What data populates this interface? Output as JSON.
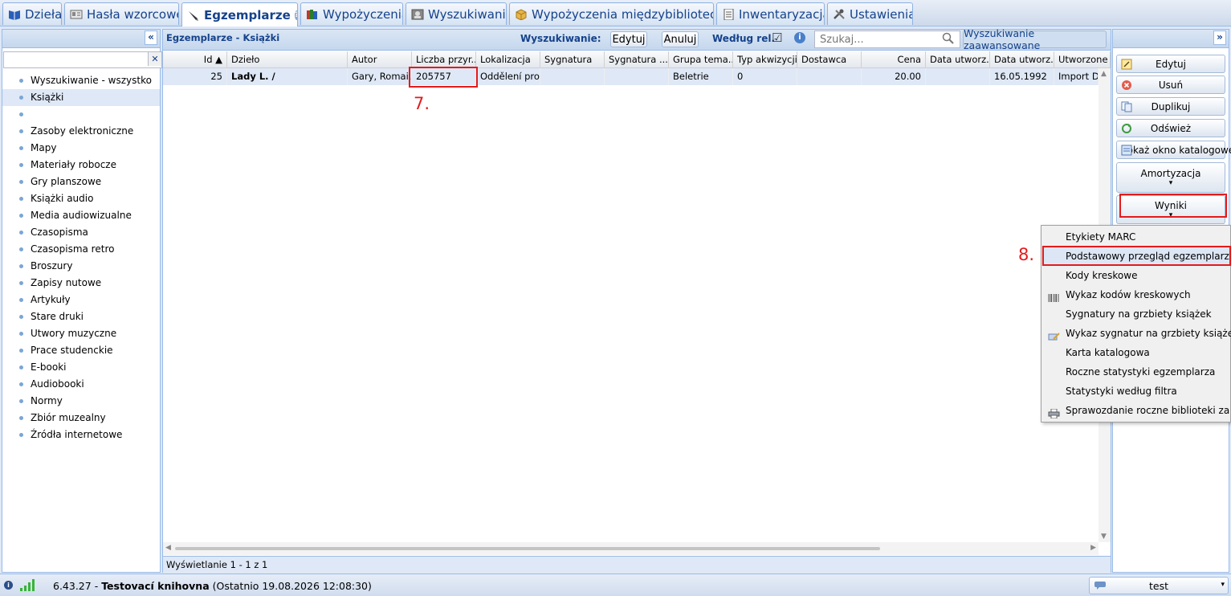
{
  "tabs": [
    {
      "label": "Dzieła",
      "icon": "book-icon"
    },
    {
      "label": "Hasła wzorcowe",
      "icon": "card-icon"
    },
    {
      "label": "Egzemplarze",
      "icon": "pen-icon"
    },
    {
      "label": "Wypożyczenia",
      "icon": "books-icon"
    },
    {
      "label": "Wyszukiwanie",
      "icon": "photo-icon"
    },
    {
      "label": "Wypożyczenia międzybiblioteczne",
      "icon": "box-icon"
    },
    {
      "label": "Inwentaryzacja",
      "icon": "document-icon"
    },
    {
      "label": "Ustawienia",
      "icon": "tools-icon"
    }
  ],
  "sidebar": {
    "collapse_glyph": "«",
    "clear_glyph": "✕",
    "items": [
      "Wyszukiwanie - wszystko",
      "Książki",
      "",
      "Zasoby elektroniczne",
      "Mapy",
      "Materiały robocze",
      "Gry planszowe",
      "Książki audio",
      "Media audiowizualne",
      "Czasopisma",
      "Czasopisma retro",
      "Broszury",
      "Zapisy nutowe",
      "Artykuły",
      "Stare druki",
      "Utwory muzyczne",
      "Prace studenckie",
      "E-booki",
      "Audiobooki",
      "Normy",
      "Zbiór muzealny",
      "Źródła internetowe"
    ]
  },
  "center": {
    "title": "Egzemplarze - Książki",
    "search_label": "Wyszukiwanie:",
    "edit_label": "Edytuj",
    "cancel_label": "Anuluj",
    "relevance_label": "Według rel.",
    "relevance_checked": "☑",
    "info_glyph": "i",
    "search_placeholder": "Szukaj...",
    "advanced_label": "Wyszukiwanie zaawansowane",
    "footer": "Wyświetlanie 1 - 1 z 1"
  },
  "grid": {
    "columns": [
      "Id ▲",
      "Dzieło",
      "Autor",
      "Liczba przyr...",
      "Lokalizacja",
      "Sygnatura",
      "Sygnatura ...",
      "Grupa tema...",
      "Typ akwizycji",
      "Dostawca",
      "Cena",
      "Data utworz...",
      "Data utworz...",
      "Utworzone ..."
    ],
    "row": [
      "25",
      "Lady L. /",
      "Gary, Romai...",
      "205757",
      "Oddělení pro...",
      "",
      "",
      "Beletrie",
      "0",
      "",
      "20.00",
      "",
      "16.05.1992",
      "Import Da"
    ]
  },
  "actions": {
    "collapse_glyph": "»",
    "edit": "Edytuj",
    "delete": "Usuń",
    "duplicate": "Duplikuj",
    "refresh": "Odśwież",
    "catalog": "Pokaż okno katalogowe",
    "amortization": "Amortyzacja",
    "results": "Wyniki",
    "dropdown_glyph": "▾"
  },
  "results_menu": [
    {
      "label": "Etykiety MARC",
      "icon": ""
    },
    {
      "label": "Podstawowy przegląd egzemplarzy",
      "icon": ""
    },
    {
      "label": "Kody kreskowe",
      "icon": ""
    },
    {
      "label": "Wykaz kodów kreskowych",
      "icon": "barcode-icon"
    },
    {
      "label": "Sygnatury na grzbiety książek",
      "icon": ""
    },
    {
      "label": "Wykaz sygnatur na grzbiety książek",
      "icon": "label-pen-icon"
    },
    {
      "label": "Karta katalogowa",
      "icon": ""
    },
    {
      "label": "Roczne statystyki egzemplarza",
      "icon": ""
    },
    {
      "label": "Statystyki według filtra",
      "icon": ""
    },
    {
      "label": "Sprawozdanie roczne biblioteki za rok",
      "icon": "printer-icon"
    }
  ],
  "annotations": {
    "step7": "7.",
    "step8": "8."
  },
  "status": {
    "version": "6.43.27",
    "separator": " - ",
    "library": "Testovací knihovna",
    "last": "(Ostatnio 19.08.2026 12:08:30)",
    "user": "test"
  },
  "colors": {
    "highlight": "#e41b1b",
    "accent": "#15428b",
    "selection": "#dfe8f6"
  }
}
